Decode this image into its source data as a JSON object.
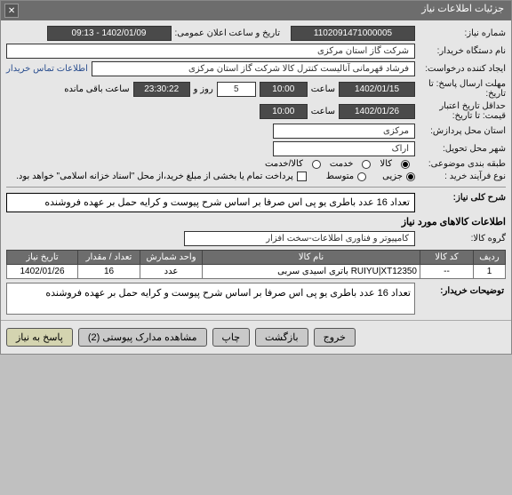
{
  "window": {
    "title": "جزئیات اطلاعات نیاز"
  },
  "labels": {
    "need_no": "شماره نیاز:",
    "ann_datetime": "تاریخ و ساعت اعلان عمومی:",
    "device": "نام دستگاه خریدار:",
    "requester": "ایجاد کننده درخواست:",
    "deadline": "مهلت ارسال پاسخ: تا تاریخ:",
    "min_valid": "حداقل تاریخ اعتبار قیمت: تا تاریخ:",
    "process_loc": "استان محل پردازش:",
    "delivery_city": "شهر محل تحویل:",
    "category": "طبقه بندی موضوعی:",
    "buy_type": "نوع فرآیند خرید :",
    "hour": "ساعت",
    "day_and": "روز و",
    "remain": "ساعت باقی مانده",
    "goods": "کالا",
    "service": "خدمت",
    "goods_service": "کالا/خدمت",
    "minor": "جزیی",
    "medium": "متوسط",
    "pay_note": "پرداخت تمام یا بخشی از مبلغ خرید،از محل \"اسناد خزانه اسلامی\" خواهد بود.",
    "contact_info": "اطلاعات تماس خریدار",
    "need_brief_head": "شرح کلی نیاز:",
    "items_head": "اطلاعات کالاهای مورد نیاز",
    "group": "گروه کالا:",
    "buyer_notes": "توضیحات خریدار:"
  },
  "values": {
    "need_no": "1102091471000005",
    "ann_date": "1402/01/09 - 09:13",
    "device": "شرکت گاز استان مرکزی",
    "requester": "فرشاد قهرمانی آنالیست کنترل کالا شرکت گاز استان مرکزی",
    "deadline_date": "1402/01/15",
    "deadline_time": "10:00",
    "deadline_days": "5",
    "deadline_remain": "23:30:22",
    "valid_date": "1402/01/26",
    "valid_time": "10:00",
    "province": "مرکزی",
    "city": "اراک",
    "minor_checked": true,
    "medium_checked": false,
    "paynote_checked": false,
    "need_brief": "تعداد 16 عدد باطری یو پی اس صرفا بر اساس شرح پیوست و کرایه حمل بر عهده فروشنده",
    "group": "کامپیوتر و فناوری اطلاعات-سخت افزار",
    "buyer_notes": "تعداد 16 عدد باطری یو پی اس صرفا بر اساس شرح پیوست و کرایه حمل بر عهده فروشنده"
  },
  "category_radio": {
    "selected": "goods"
  },
  "table": {
    "headers": {
      "row": "ردیف",
      "code": "کد کالا",
      "name": "نام کالا",
      "unit": "واحد شمارش",
      "qty": "تعداد / مقدار",
      "date": "تاریخ نیاز"
    },
    "rows": [
      {
        "row": "1",
        "code": "--",
        "name": "باتری اسیدی سربی RUIYU|XT12350",
        "unit": "عدد",
        "qty": "16",
        "date": "1402/01/26"
      }
    ]
  },
  "footer": {
    "respond": "پاسخ به نیاز",
    "attachments": "مشاهده مدارک پیوستی (2)",
    "print": "چاپ",
    "back": "بازگشت",
    "exit": "خروج"
  }
}
